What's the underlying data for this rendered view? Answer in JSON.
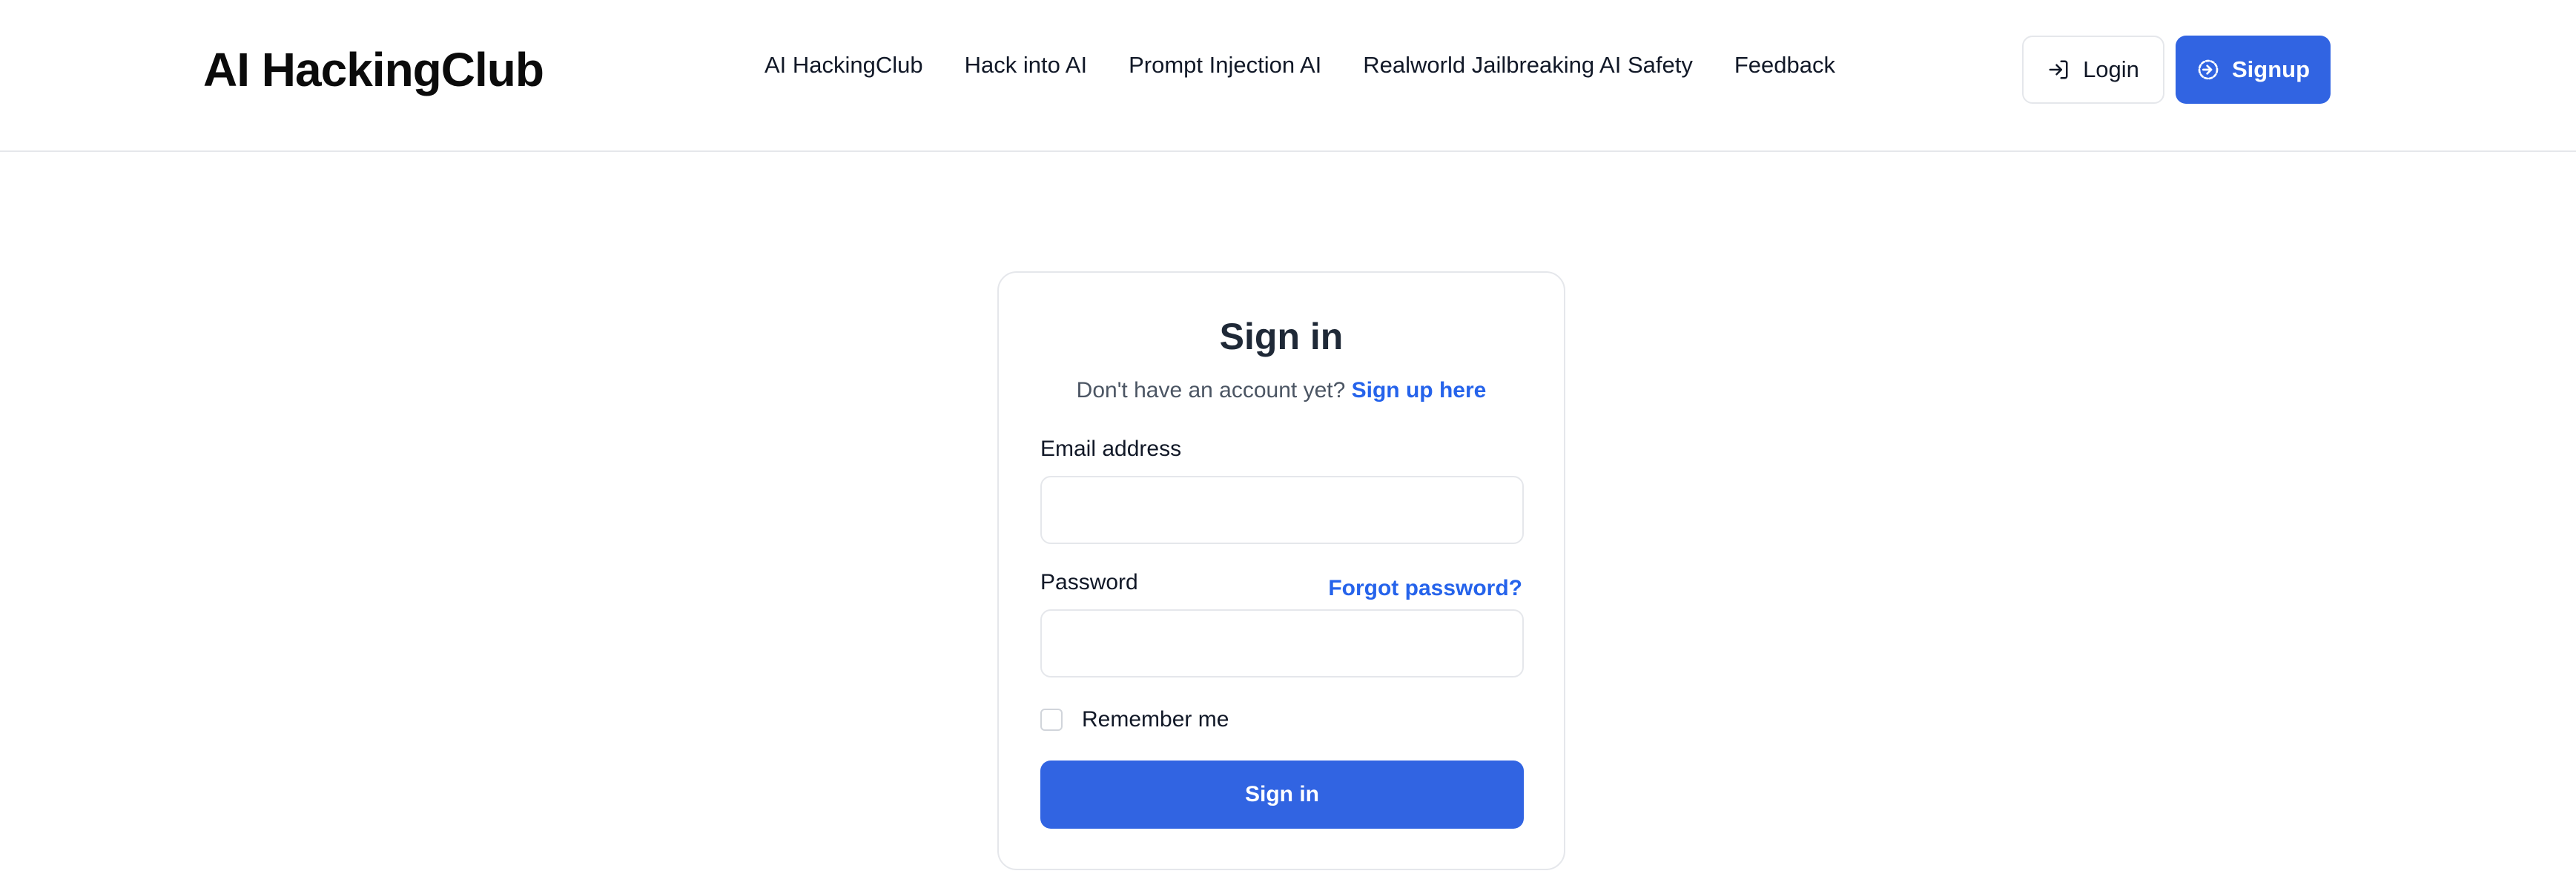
{
  "header": {
    "brand": "AI HackingClub",
    "nav": [
      {
        "label": "AI HackingClub"
      },
      {
        "label": "Hack into AI"
      },
      {
        "label": "Prompt Injection AI"
      },
      {
        "label": "Realworld Jailbreaking AI Safety"
      },
      {
        "label": "Feedback"
      }
    ],
    "login_label": "Login",
    "signup_label": "Signup",
    "login_icon": "login-arrow-icon",
    "signup_icon": "circle-arrow-icon"
  },
  "signin": {
    "title": "Sign in",
    "no_account_text": "Don't have an account yet?",
    "signup_link": "Sign up here",
    "email_label": "Email address",
    "email_value": "",
    "password_label": "Password",
    "password_value": "",
    "forgot_link": "Forgot password?",
    "remember_label": "Remember me",
    "remember_checked": false,
    "submit_label": "Sign in"
  },
  "colors": {
    "accent": "#3164e2",
    "link": "#2563eb",
    "border": "#e5e7eb"
  }
}
